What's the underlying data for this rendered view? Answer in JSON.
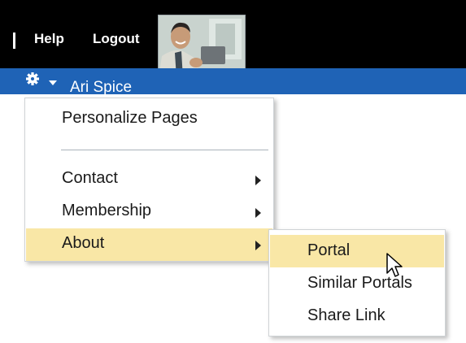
{
  "header": {
    "help_label": "Help",
    "logout_label": "Logout"
  },
  "user": {
    "name": "Ari Spice"
  },
  "menu": {
    "items": [
      {
        "label": "Personalize Pages",
        "has_submenu": false
      },
      {
        "label": "Contact",
        "has_submenu": true
      },
      {
        "label": "Membership",
        "has_submenu": true
      },
      {
        "label": "About",
        "has_submenu": true,
        "highlighted": true
      }
    ]
  },
  "submenu": {
    "items": [
      {
        "label": "Portal",
        "highlighted": true
      },
      {
        "label": "Similar Portals"
      },
      {
        "label": "Share Link"
      }
    ]
  },
  "colors": {
    "top_bar": "#000000",
    "user_bar": "#1f63b6",
    "highlight": "#f9e7a6"
  },
  "icons": {
    "gear": "gear-icon",
    "dropdown": "chevron-down-icon",
    "submenu_arrow": "chevron-right-icon",
    "cursor": "mouse-pointer-icon"
  }
}
